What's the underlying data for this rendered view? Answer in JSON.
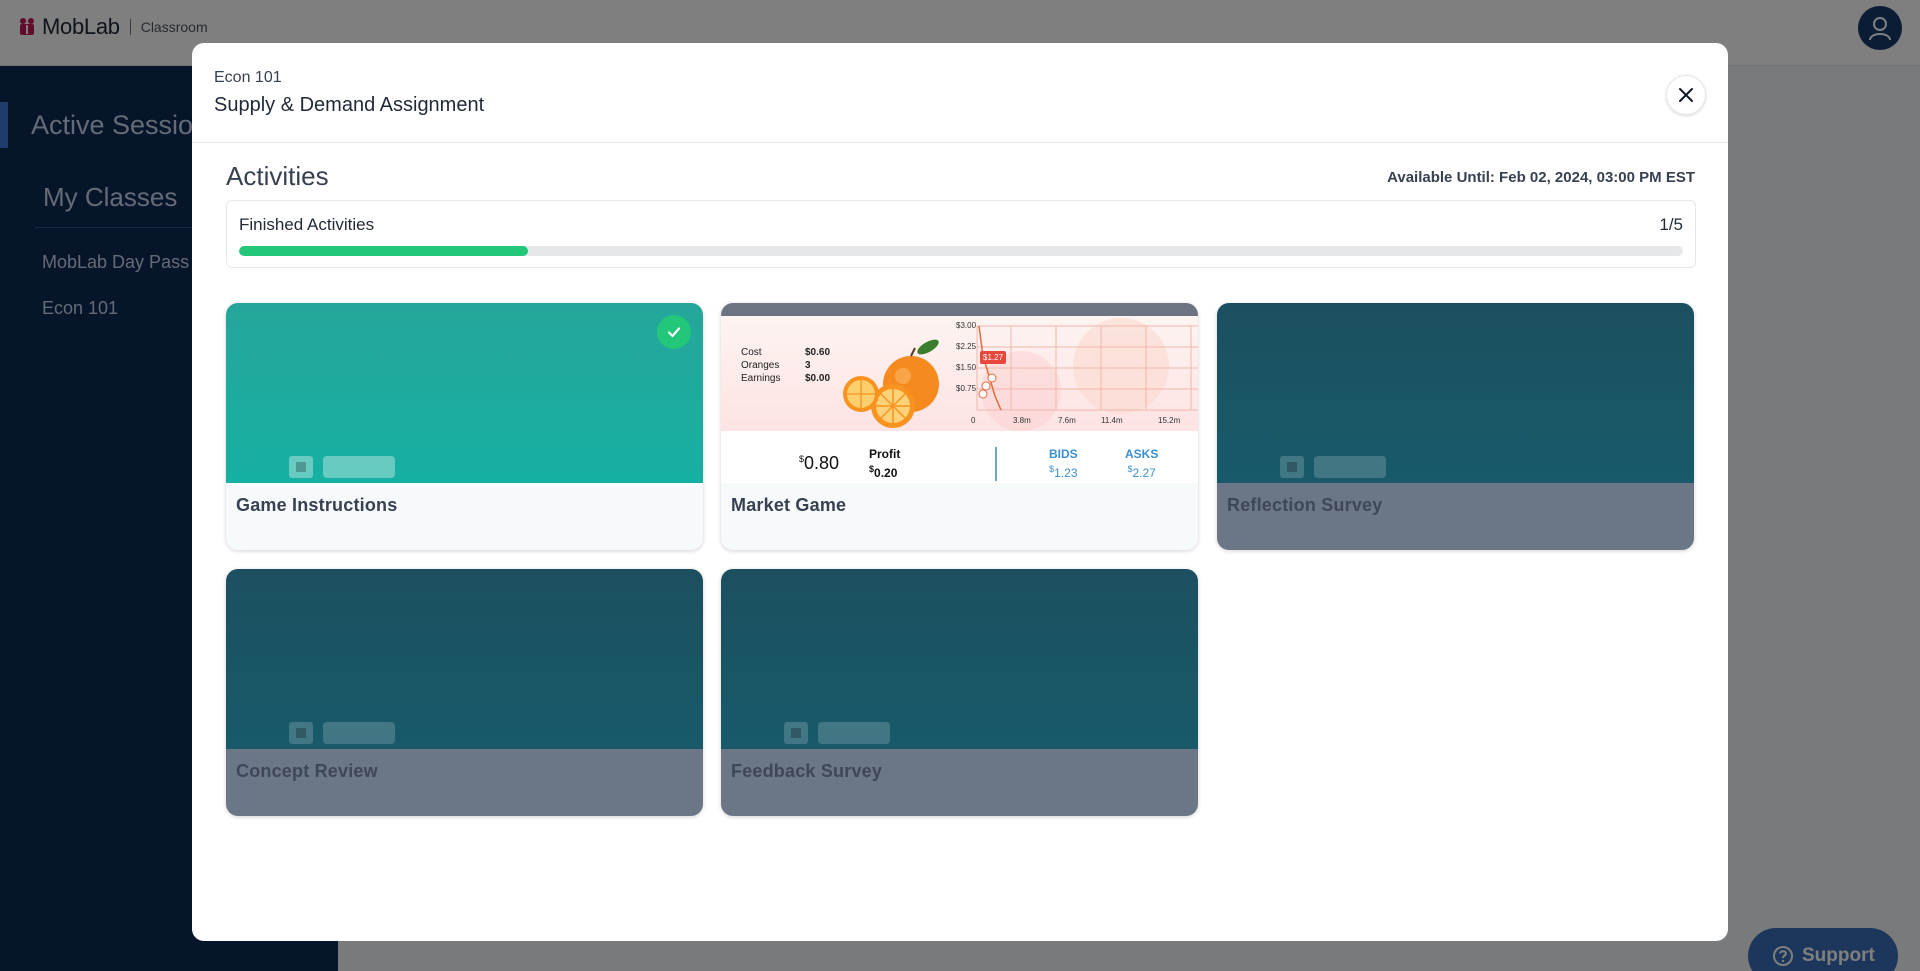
{
  "app": {
    "logo_text": "MobLab",
    "logo_sub": "Classroom",
    "support_label": "Support"
  },
  "sidebar": {
    "active_label": "Active Sessio",
    "heading": "My Classes",
    "items": [
      {
        "label": "MobLab Day Pass"
      },
      {
        "label": "Econ 101"
      }
    ]
  },
  "modal": {
    "course": "Econ 101",
    "title": "Supply & Demand Assignment",
    "activities_title": "Activities",
    "available_until": "Available Until: Feb 02, 2024, 03:00 PM EST",
    "progress": {
      "label": "Finished Activities",
      "count_text": "1/5",
      "fraction": 0.2
    },
    "cards": [
      {
        "title": "Game Instructions",
        "status": "completed"
      },
      {
        "title": "Market Game",
        "status": "available"
      },
      {
        "title": "Reflection Survey",
        "status": "locked"
      },
      {
        "title": "Concept Review",
        "status": "locked"
      },
      {
        "title": "Feedback Survey",
        "status": "locked"
      }
    ]
  },
  "market_thumb": {
    "stats": [
      {
        "k": "Cost",
        "v": "$0.60"
      },
      {
        "k": "Oranges",
        "v": "3"
      },
      {
        "k": "Earnings",
        "v": "$0.00"
      }
    ],
    "y_ticks": [
      "$3.00",
      "$2.25",
      "$1.50",
      "$0.75"
    ],
    "x_ticks": [
      "0",
      "3.8m",
      "7.6m",
      "11.4m",
      "15.2m"
    ],
    "marker": "$1.27",
    "price": "0.80",
    "profit_label": "Profit",
    "profit_value": "0.20",
    "bids_label": "BIDS",
    "bids_value": "1.23",
    "asks_label": "ASKS",
    "asks_value": "2.27"
  },
  "colors": {
    "sidebar": "#0f2a55",
    "progress": "#22c77a",
    "card_teal": "#1aa89c",
    "card_locked": "#185a6a"
  }
}
